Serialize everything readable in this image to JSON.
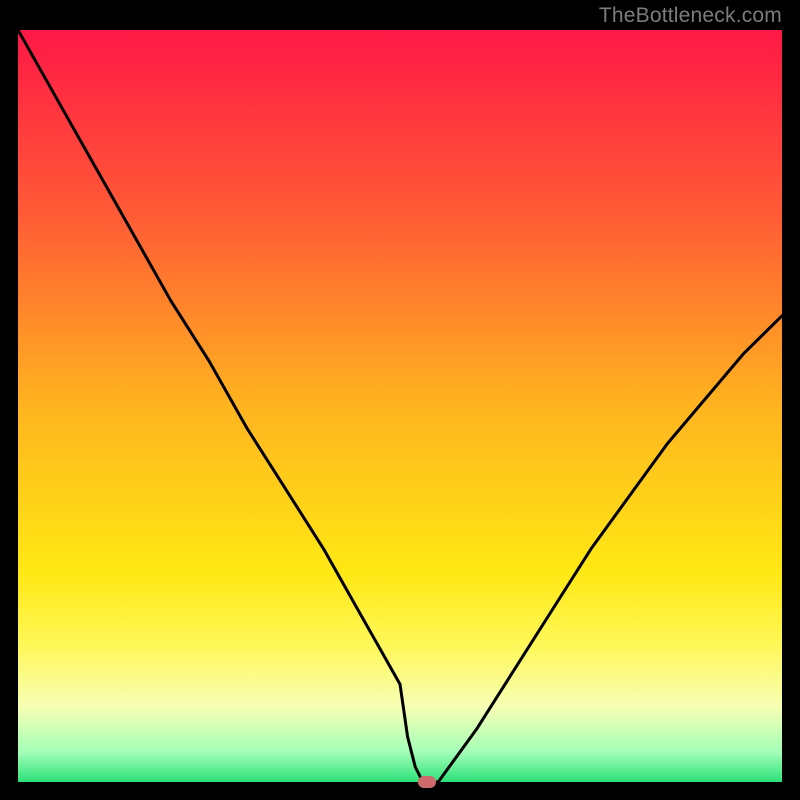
{
  "watermark": "TheBottleneck.com",
  "chart_data": {
    "type": "line",
    "title": "",
    "xlabel": "",
    "ylabel": "",
    "xlim": [
      0,
      100
    ],
    "ylim": [
      0,
      100
    ],
    "x": [
      0,
      5,
      10,
      15,
      20,
      25,
      30,
      35,
      40,
      45,
      50,
      51,
      52,
      53,
      54,
      55,
      60,
      65,
      70,
      75,
      80,
      85,
      90,
      95,
      100
    ],
    "values": [
      100,
      91,
      82,
      73,
      64,
      56,
      47,
      39,
      31,
      22,
      13,
      6,
      2,
      0,
      0,
      0,
      7,
      15,
      23,
      31,
      38,
      45,
      51,
      57,
      62
    ],
    "marker": {
      "x": 53.5,
      "y": 0
    },
    "gradient_stops": [
      {
        "pos": 0.0,
        "color": "#ff1846"
      },
      {
        "pos": 0.25,
        "color": "#ff5c35"
      },
      {
        "pos": 0.5,
        "color": "#ffb41f"
      },
      {
        "pos": 0.72,
        "color": "#ffe813"
      },
      {
        "pos": 0.82,
        "color": "#fff85a"
      },
      {
        "pos": 0.9,
        "color": "#f6ffb4"
      },
      {
        "pos": 0.96,
        "color": "#a4ffb8"
      },
      {
        "pos": 1.0,
        "color": "#2be079"
      }
    ]
  }
}
